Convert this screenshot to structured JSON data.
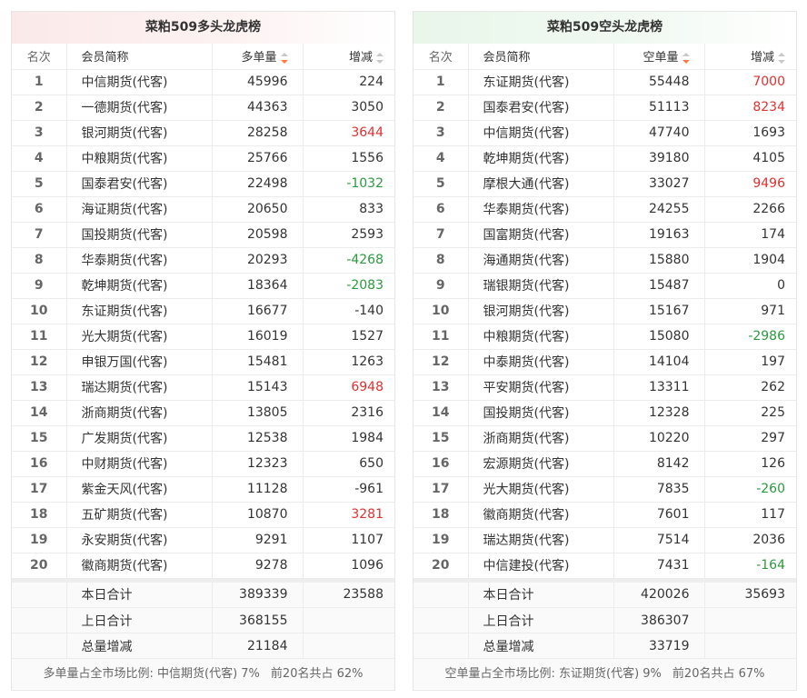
{
  "long": {
    "title": "菜粕509多头龙虎榜",
    "headers": {
      "rank": "名次",
      "name": "会员简称",
      "volume": "多单量",
      "change": "增减"
    },
    "rows": [
      {
        "rank": "1",
        "name": "中信期货(代客)",
        "volume": "45996",
        "change": "224",
        "trend": "neutral"
      },
      {
        "rank": "2",
        "name": "一德期货(代客)",
        "volume": "44363",
        "change": "3050",
        "trend": "neutral"
      },
      {
        "rank": "3",
        "name": "银河期货(代客)",
        "volume": "28258",
        "change": "3644",
        "trend": "up"
      },
      {
        "rank": "4",
        "name": "中粮期货(代客)",
        "volume": "25766",
        "change": "1556",
        "trend": "neutral"
      },
      {
        "rank": "5",
        "name": "国泰君安(代客)",
        "volume": "22498",
        "change": "-1032",
        "trend": "down"
      },
      {
        "rank": "6",
        "name": "海证期货(代客)",
        "volume": "20650",
        "change": "833",
        "trend": "neutral"
      },
      {
        "rank": "7",
        "name": "国投期货(代客)",
        "volume": "20598",
        "change": "2593",
        "trend": "neutral"
      },
      {
        "rank": "8",
        "name": "华泰期货(代客)",
        "volume": "20293",
        "change": "-4268",
        "trend": "down"
      },
      {
        "rank": "9",
        "name": "乾坤期货(代客)",
        "volume": "18364",
        "change": "-2083",
        "trend": "down"
      },
      {
        "rank": "10",
        "name": "东证期货(代客)",
        "volume": "16677",
        "change": "-140",
        "trend": "neutral"
      },
      {
        "rank": "11",
        "name": "光大期货(代客)",
        "volume": "16019",
        "change": "1527",
        "trend": "neutral"
      },
      {
        "rank": "12",
        "name": "申银万国(代客)",
        "volume": "15481",
        "change": "1263",
        "trend": "neutral"
      },
      {
        "rank": "13",
        "name": "瑞达期货(代客)",
        "volume": "15143",
        "change": "6948",
        "trend": "up"
      },
      {
        "rank": "14",
        "name": "浙商期货(代客)",
        "volume": "13805",
        "change": "2316",
        "trend": "neutral"
      },
      {
        "rank": "15",
        "name": "广发期货(代客)",
        "volume": "12538",
        "change": "1984",
        "trend": "neutral"
      },
      {
        "rank": "16",
        "name": "中财期货(代客)",
        "volume": "12323",
        "change": "650",
        "trend": "neutral"
      },
      {
        "rank": "17",
        "name": "紫金天风(代客)",
        "volume": "11128",
        "change": "-961",
        "trend": "neutral"
      },
      {
        "rank": "18",
        "name": "五矿期货(代客)",
        "volume": "10870",
        "change": "3281",
        "trend": "up"
      },
      {
        "rank": "19",
        "name": "永安期货(代客)",
        "volume": "9291",
        "change": "1107",
        "trend": "neutral"
      },
      {
        "rank": "20",
        "name": "徽商期货(代客)",
        "volume": "9278",
        "change": "1096",
        "trend": "neutral"
      }
    ],
    "totals": [
      {
        "label": "本日合计",
        "volume": "389339",
        "change": "23588"
      },
      {
        "label": "上日合计",
        "volume": "368155",
        "change": ""
      },
      {
        "label": "总量增减",
        "volume": "21184",
        "change": ""
      }
    ],
    "footer": {
      "share": "多单量占全市场比例: 中信期货(代客) 7%",
      "top20": "前20名共占 62%"
    }
  },
  "short": {
    "title": "菜粕509空头龙虎榜",
    "headers": {
      "rank": "名次",
      "name": "会员简称",
      "volume": "空单量",
      "change": "增减"
    },
    "rows": [
      {
        "rank": "1",
        "name": "东证期货(代客)",
        "volume": "55448",
        "change": "7000",
        "trend": "up"
      },
      {
        "rank": "2",
        "name": "国泰君安(代客)",
        "volume": "51113",
        "change": "8234",
        "trend": "up"
      },
      {
        "rank": "3",
        "name": "中信期货(代客)",
        "volume": "47740",
        "change": "1693",
        "trend": "neutral"
      },
      {
        "rank": "4",
        "name": "乾坤期货(代客)",
        "volume": "39180",
        "change": "4105",
        "trend": "neutral"
      },
      {
        "rank": "5",
        "name": "摩根大通(代客)",
        "volume": "33027",
        "change": "9496",
        "trend": "up"
      },
      {
        "rank": "6",
        "name": "华泰期货(代客)",
        "volume": "24255",
        "change": "2266",
        "trend": "neutral"
      },
      {
        "rank": "7",
        "name": "国富期货(代客)",
        "volume": "19163",
        "change": "174",
        "trend": "neutral"
      },
      {
        "rank": "8",
        "name": "海通期货(代客)",
        "volume": "15880",
        "change": "1904",
        "trend": "neutral"
      },
      {
        "rank": "9",
        "name": "瑞银期货(代客)",
        "volume": "15487",
        "change": "0",
        "trend": "neutral"
      },
      {
        "rank": "10",
        "name": "银河期货(代客)",
        "volume": "15167",
        "change": "971",
        "trend": "neutral"
      },
      {
        "rank": "11",
        "name": "中粮期货(代客)",
        "volume": "15080",
        "change": "-2986",
        "trend": "down"
      },
      {
        "rank": "12",
        "name": "中泰期货(代客)",
        "volume": "14104",
        "change": "197",
        "trend": "neutral"
      },
      {
        "rank": "13",
        "name": "平安期货(代客)",
        "volume": "13311",
        "change": "262",
        "trend": "neutral"
      },
      {
        "rank": "14",
        "name": "国投期货(代客)",
        "volume": "12328",
        "change": "225",
        "trend": "neutral"
      },
      {
        "rank": "15",
        "name": "浙商期货(代客)",
        "volume": "10220",
        "change": "297",
        "trend": "neutral"
      },
      {
        "rank": "16",
        "name": "宏源期货(代客)",
        "volume": "8142",
        "change": "126",
        "trend": "neutral"
      },
      {
        "rank": "17",
        "name": "光大期货(代客)",
        "volume": "7835",
        "change": "-260",
        "trend": "down"
      },
      {
        "rank": "18",
        "name": "徽商期货(代客)",
        "volume": "7601",
        "change": "117",
        "trend": "neutral"
      },
      {
        "rank": "19",
        "name": "瑞达期货(代客)",
        "volume": "7514",
        "change": "2036",
        "trend": "neutral"
      },
      {
        "rank": "20",
        "name": "中信建投(代客)",
        "volume": "7431",
        "change": "-164",
        "trend": "down"
      }
    ],
    "totals": [
      {
        "label": "本日合计",
        "volume": "420026",
        "change": "35693"
      },
      {
        "label": "上日合计",
        "volume": "386307",
        "change": ""
      },
      {
        "label": "总量增减",
        "volume": "33719",
        "change": ""
      }
    ],
    "footer": {
      "share": "空单量占全市场比例: 东证期货(代客) 9%",
      "top20": "前20名共占 67%"
    }
  },
  "colors": {
    "up": "#e03030",
    "down": "#2a9a3e",
    "sort_active": "#ff7a45"
  }
}
